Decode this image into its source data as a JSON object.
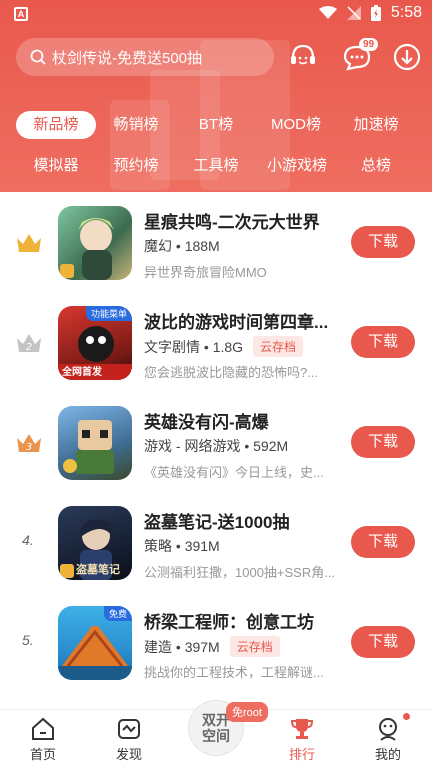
{
  "status_bar": {
    "time": "5:58",
    "app_icon_letter": "A"
  },
  "search": {
    "placeholder": "杖剑传说-免费送500抽"
  },
  "header": {
    "message_badge": "99"
  },
  "tabs_row1": [
    "新品榜",
    "畅销榜",
    "BT榜",
    "MOD榜",
    "加速榜"
  ],
  "tabs_row2": [
    "模拟器",
    "预约榜",
    "工具榜",
    "小游戏榜",
    "总榜"
  ],
  "active_tab": "新品榜",
  "apps": [
    {
      "rank": "1",
      "name": "星痕共鸣-二次元大世界",
      "category": "魔幻",
      "size": "188M",
      "cloud": "",
      "desc": "异世界奇旅冒险MMO",
      "icon_tag": "",
      "button": "下载"
    },
    {
      "rank": "2",
      "name": "波比的游戏时间第四章...",
      "category": "文字剧情",
      "size": "1.8G",
      "cloud": "云存档",
      "desc": "您会逃脱波比隐藏的恐怖吗?...",
      "icon_tag": "功能菜单",
      "icon_tag2": "全网首发",
      "button": "下载"
    },
    {
      "rank": "3",
      "name": "英雄没有闪-高爆",
      "category": "游戏 - 网络游戏",
      "size": "592M",
      "cloud": "",
      "desc": "《英雄没有闪》今日上线，史...",
      "icon_tag": "",
      "button": "下载"
    },
    {
      "rank": "4.",
      "name": "盗墓笔记-送1000抽",
      "category": "策略",
      "size": "391M",
      "cloud": "",
      "desc": "公测福利狂撒，1000抽+SSR角...",
      "icon_tag": "",
      "icon_caption": "盗墓笔记",
      "button": "下载"
    },
    {
      "rank": "5.",
      "name": "桥梁工程师：创意工坊",
      "category": "建造",
      "size": "397M",
      "cloud": "云存档",
      "desc": "挑战你的工程技术，工程解谜...",
      "icon_tag": "免费",
      "button": "下载"
    }
  ],
  "bottom_nav": {
    "items": [
      "首页",
      "发现",
      "排行",
      "我的"
    ],
    "center_label_line1": "双开",
    "center_label_line2": "空间",
    "center_badge": "免root",
    "active": "排行"
  },
  "colors": {
    "accent": "#e9584c",
    "gold": "#f0b33a",
    "silver": "#b8b8b8",
    "bronze": "#e9954f"
  }
}
